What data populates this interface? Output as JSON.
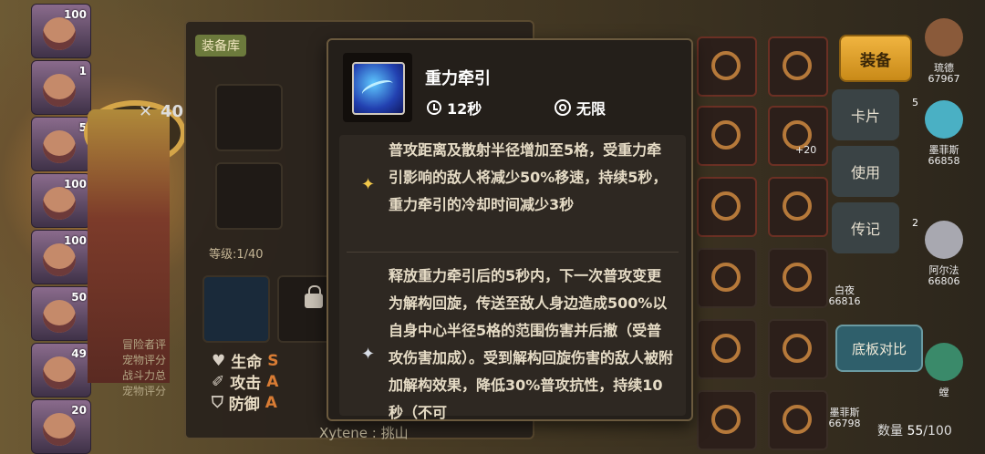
{
  "library": {
    "tab_label": "装备库",
    "level_label": "等级:1/40",
    "x_prefix": "40",
    "stats": [
      {
        "icon": "heart-icon",
        "label": "生命",
        "grade": "S"
      },
      {
        "icon": "sword-icon",
        "label": "攻击",
        "grade": "A"
      },
      {
        "icon": "shield-icon",
        "label": "防御",
        "grade": "A"
      }
    ],
    "info_lines": [
      "冒险者评",
      "宠物评分",
      "战斗力总",
      "宠物评分"
    ]
  },
  "roster_counts": [
    "100",
    "1",
    "5",
    "100",
    "100",
    "50",
    "49",
    "20"
  ],
  "tooltip": {
    "skill_name": "重力牵引",
    "cooldown": "12秒",
    "uses": "无限",
    "effects": [
      {
        "star": "gold-star-icon",
        "text": "普攻距离及散射半径增加至5格，受重力牵引影响的敌人将减少50%移速，持续5秒，重力牵引的冷却时间减少3秒"
      },
      {
        "star": "silver-star-icon",
        "text": "释放重力牵引后的5秒内，下一次普攻变更为解构回旋，传送至敌人身边造成500%以自身中心半径5格的范围伤害并后撤（受普攻伤害加成）。受到解构回旋伤害的敌人被附加解构效果，降低30%普攻抗性，持续10秒（不可"
      }
    ]
  },
  "buttons": {
    "equip": "装备",
    "card": "卡片",
    "use": "使用",
    "biography": "传记",
    "compare": "底板对比"
  },
  "inventory": {
    "count_label": "数量",
    "count_current": "55",
    "count_total": "/100",
    "enhance_badge": "+20"
  },
  "heroes": [
    {
      "level": "",
      "name": "琉德",
      "power": "67967"
    },
    {
      "level": "5",
      "name": "墨菲斯",
      "power": "66858"
    },
    {
      "level": "2",
      "name": "阿尔法",
      "power": "66806"
    },
    {
      "level": "",
      "name": "螳",
      "power": ""
    }
  ],
  "heroes_mid": [
    {
      "name": "白夜",
      "power": "66816"
    },
    {
      "name": "墨菲斯",
      "power": "66798"
    }
  ],
  "chat_text": "Xytene : 挑山"
}
